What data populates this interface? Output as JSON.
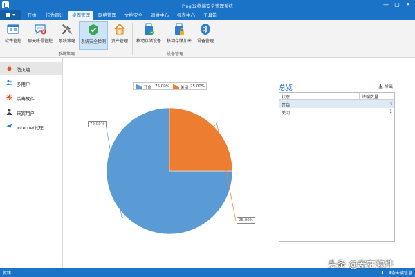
{
  "window": {
    "title": "Ping32终端安全管理系统",
    "controls": [
      "—",
      "▢",
      "✕"
    ]
  },
  "tabs": [
    {
      "label": "开始",
      "active": false
    },
    {
      "label": "行为审计",
      "active": false
    },
    {
      "label": "桌面管理",
      "active": true
    },
    {
      "label": "网络管理",
      "active": false
    },
    {
      "label": "文档安全",
      "active": false
    },
    {
      "label": "运维中心",
      "active": false
    },
    {
      "label": "报表中心",
      "active": false
    },
    {
      "label": "工具箱",
      "active": false
    }
  ],
  "ribbon": {
    "buttons": [
      {
        "label": "软件管控",
        "icon": "software-control-icon"
      },
      {
        "label": "聊天帐号管控",
        "icon": "chat-account-icon"
      },
      {
        "label": "系统策略",
        "icon": "tools-icon"
      },
      {
        "label": "系统安全检测",
        "icon": "shield-check-icon",
        "active": true
      },
      {
        "label": "资产管理",
        "icon": "asset-house-icon"
      },
      {
        "label": "移动存储设备",
        "icon": "usb-device-icon"
      },
      {
        "label": "移动存储加密",
        "icon": "usb-encrypt-icon"
      },
      {
        "label": "设备管理",
        "icon": "bluetooth-device-icon"
      }
    ],
    "groups": [
      "系统策略",
      "设备管理"
    ]
  },
  "sidebar": {
    "items": [
      {
        "label": "防火墙",
        "icon": "fire-icon",
        "active": true
      },
      {
        "label": "多用户",
        "icon": "multi-user-icon",
        "active": false
      },
      {
        "label": "杀毒软件",
        "icon": "antivirus-icon",
        "active": false
      },
      {
        "label": "来宾用户",
        "icon": "guest-user-icon",
        "active": false
      },
      {
        "label": "Internet代理",
        "icon": "proxy-icon",
        "active": false
      }
    ]
  },
  "chart_data": {
    "type": "pie",
    "categories": [
      "开启",
      "关闭"
    ],
    "values": [
      75.0,
      25.0
    ],
    "value_labels": [
      "75.00%",
      "25.00%"
    ],
    "colors": [
      "#5b9bd5",
      "#ed7d31"
    ],
    "legend": "top"
  },
  "overview": {
    "title": "总览",
    "export_label": "导出",
    "columns": [
      "状态",
      "终端数量"
    ],
    "rows": [
      {
        "status": "开启",
        "count": "3",
        "selected": true
      },
      {
        "status": "关闭",
        "count": "1",
        "selected": false
      }
    ]
  },
  "status": {
    "left": "就绪",
    "right": "4条未读信息"
  },
  "watermark": "头条 @安在软件"
}
